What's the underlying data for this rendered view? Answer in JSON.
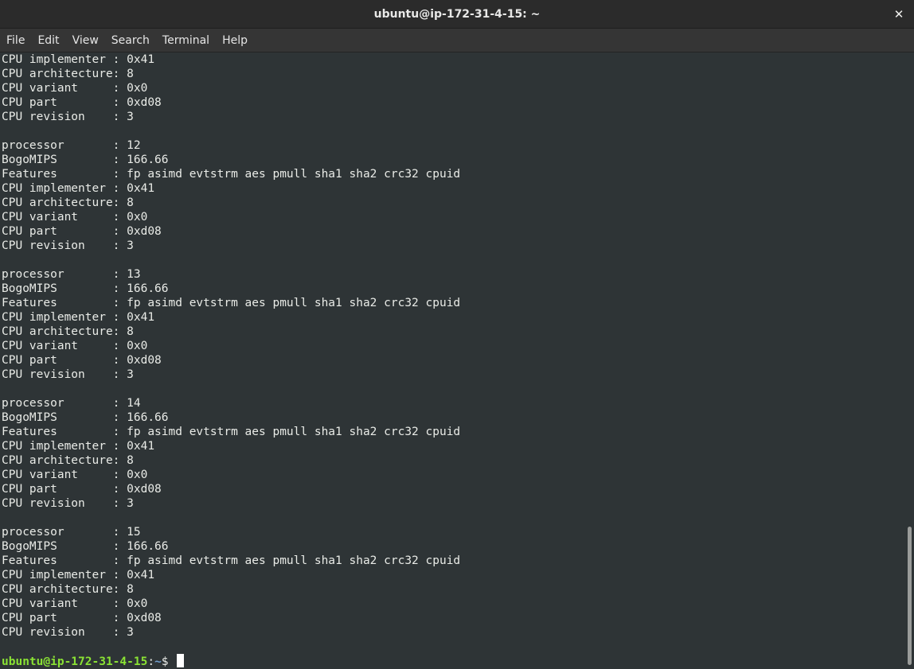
{
  "window": {
    "title": "ubuntu@ip-172-31-4-15: ~",
    "close_glyph": "✕"
  },
  "menu": {
    "items": [
      "File",
      "Edit",
      "View",
      "Search",
      "Terminal",
      "Help"
    ]
  },
  "terminal": {
    "colors": {
      "background": "#2e3436",
      "foreground": "#e9ebe7",
      "prompt_user": "#8ae234",
      "prompt_path": "#729fcf"
    },
    "lines": [
      "CPU implementer : 0x41",
      "CPU architecture: 8",
      "CPU variant     : 0x0",
      "CPU part        : 0xd08",
      "CPU revision    : 3",
      "",
      "processor       : 12",
      "BogoMIPS        : 166.66",
      "Features        : fp asimd evtstrm aes pmull sha1 sha2 crc32 cpuid",
      "CPU implementer : 0x41",
      "CPU architecture: 8",
      "CPU variant     : 0x0",
      "CPU part        : 0xd08",
      "CPU revision    : 3",
      "",
      "processor       : 13",
      "BogoMIPS        : 166.66",
      "Features        : fp asimd evtstrm aes pmull sha1 sha2 crc32 cpuid",
      "CPU implementer : 0x41",
      "CPU architecture: 8",
      "CPU variant     : 0x0",
      "CPU part        : 0xd08",
      "CPU revision    : 3",
      "",
      "processor       : 14",
      "BogoMIPS        : 166.66",
      "Features        : fp asimd evtstrm aes pmull sha1 sha2 crc32 cpuid",
      "CPU implementer : 0x41",
      "CPU architecture: 8",
      "CPU variant     : 0x0",
      "CPU part        : 0xd08",
      "CPU revision    : 3",
      "",
      "processor       : 15",
      "BogoMIPS        : 166.66",
      "Features        : fp asimd evtstrm aes pmull sha1 sha2 crc32 cpuid",
      "CPU implementer : 0x41",
      "CPU architecture: 8",
      "CPU variant     : 0x0",
      "CPU part        : 0xd08",
      "CPU revision    : 3",
      ""
    ],
    "prompt": {
      "user_host": "ubuntu@ip-172-31-4-15",
      "colon": ":",
      "path": "~",
      "symbol": "$ "
    }
  }
}
